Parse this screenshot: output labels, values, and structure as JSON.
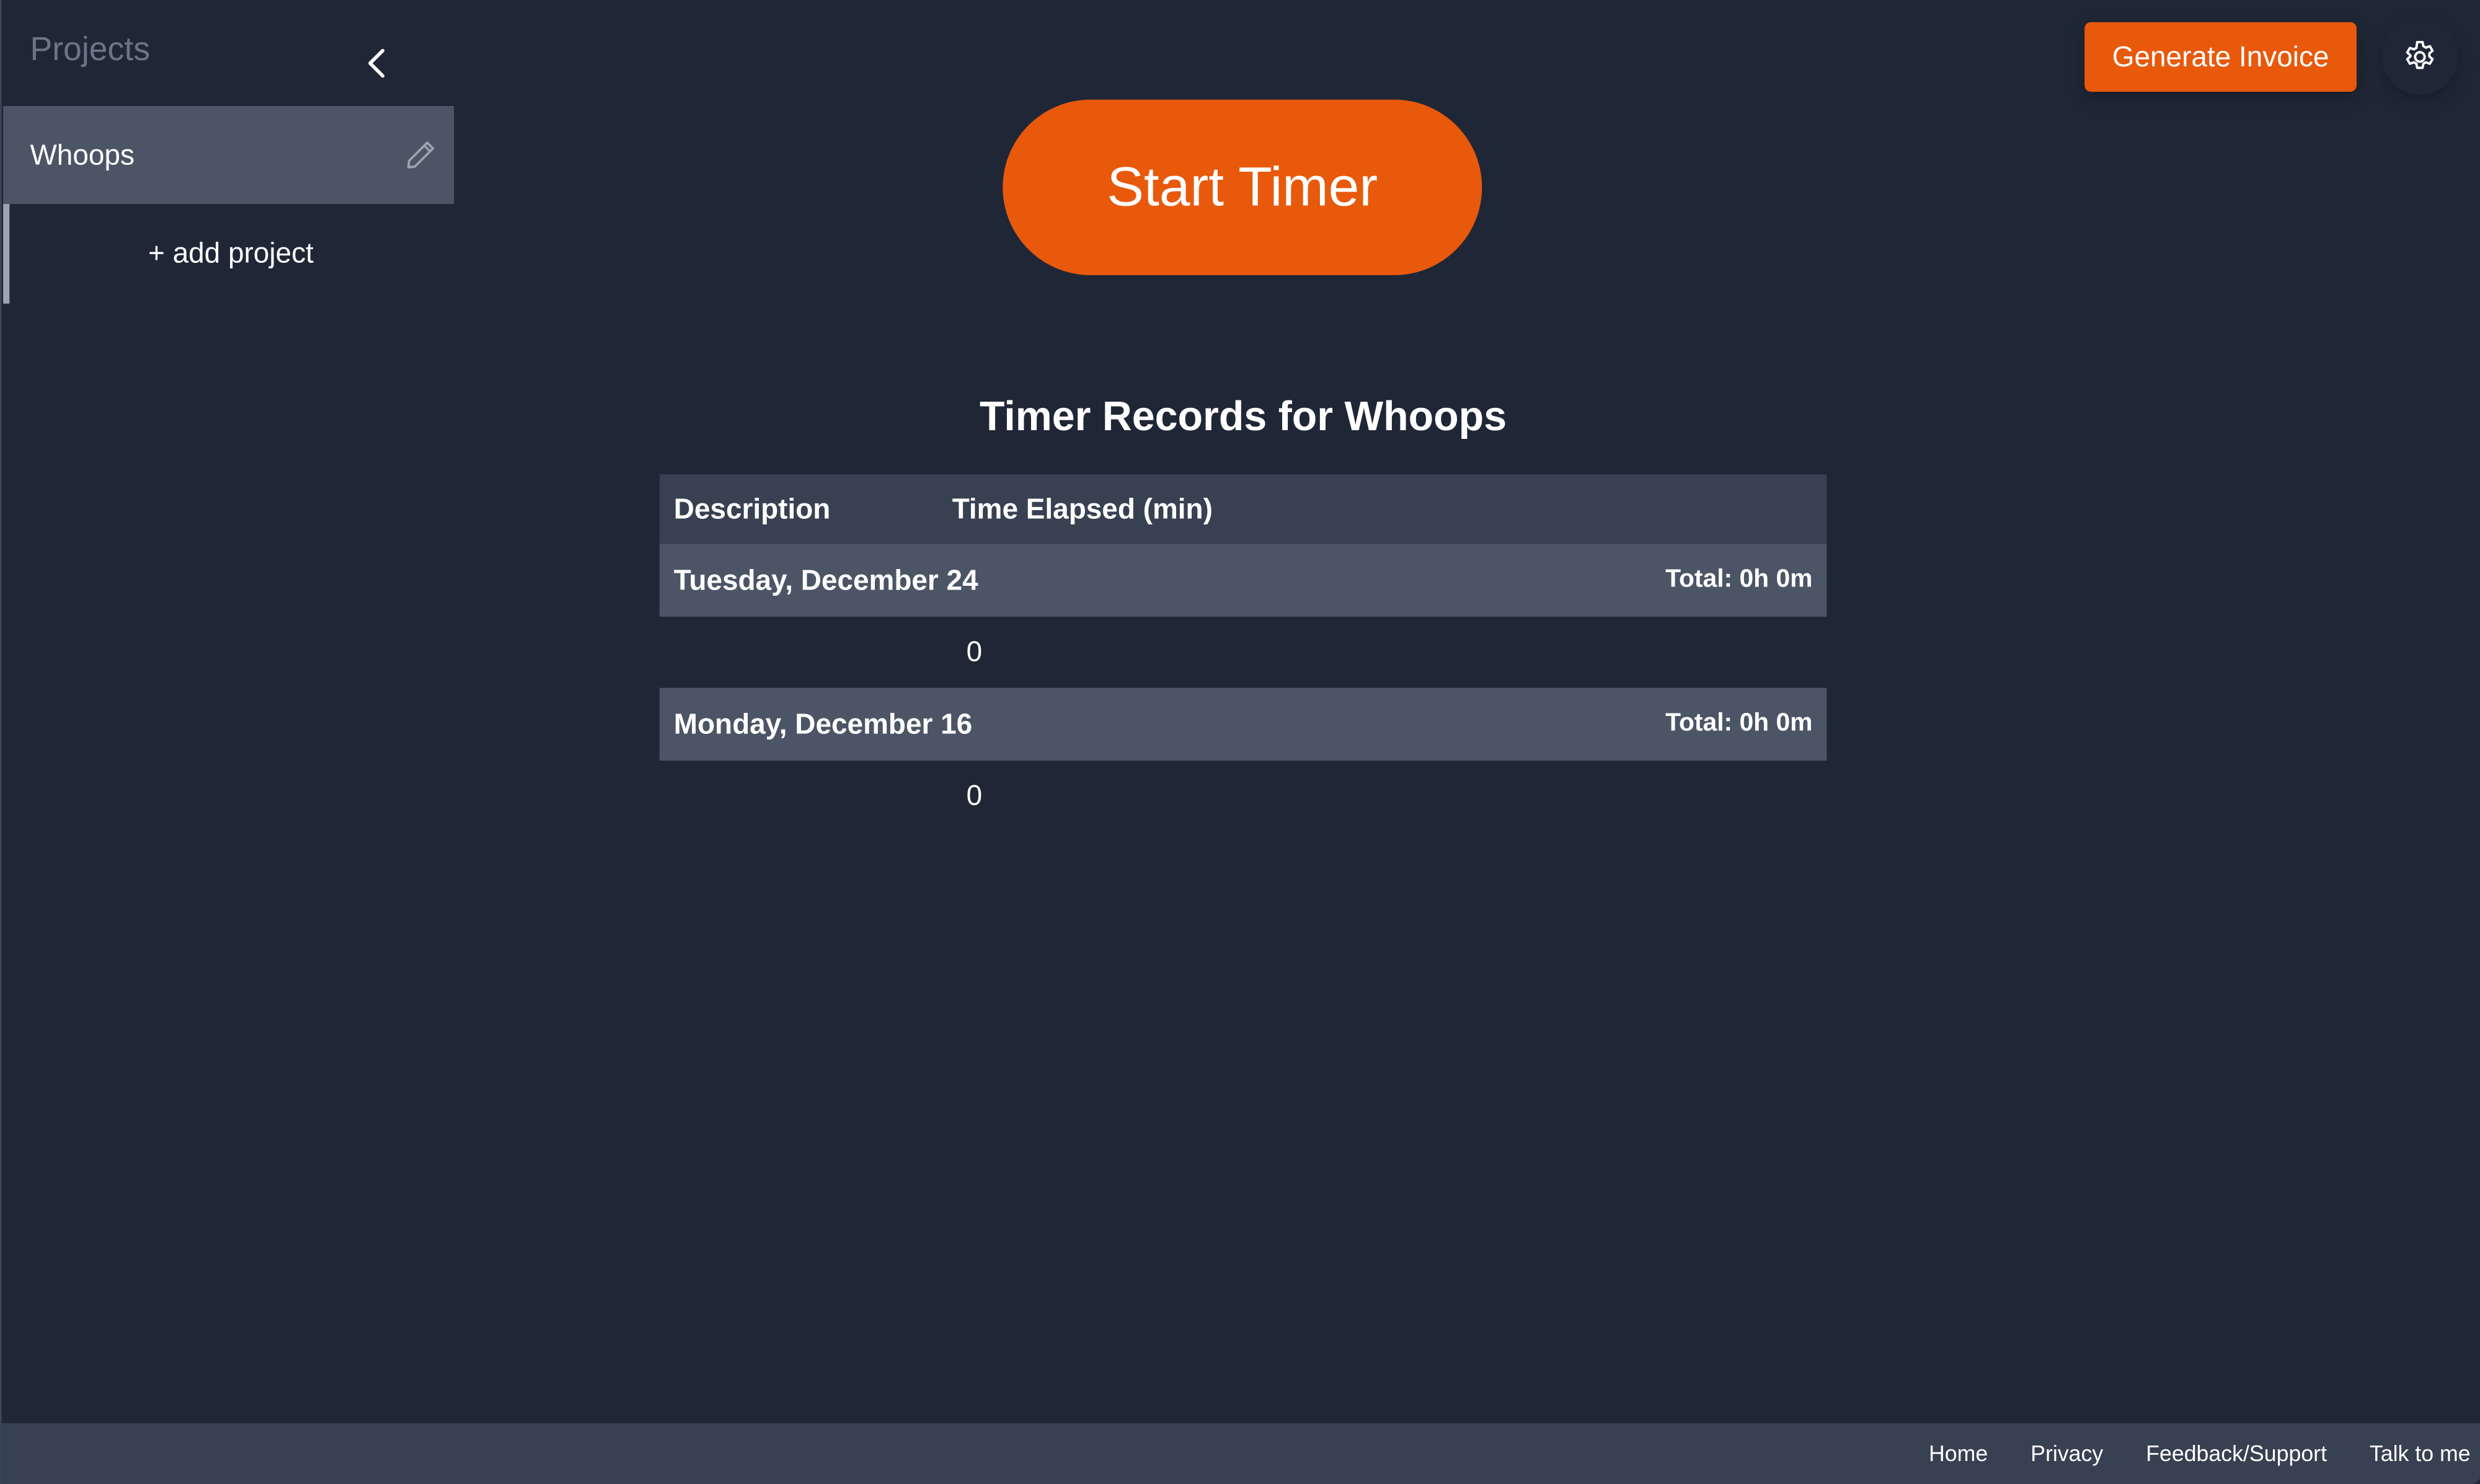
{
  "sidebar": {
    "title": "Projects",
    "projects": [
      {
        "name": "Whoops"
      }
    ],
    "add_project_label": "+ add project"
  },
  "header": {
    "generate_invoice_label": "Generate Invoice"
  },
  "timer": {
    "start_label": "Start Timer"
  },
  "records": {
    "title": "Timer Records for Whoops",
    "columns": [
      "Description",
      "Time Elapsed (min)"
    ],
    "groups": [
      {
        "date": "Tuesday, December 24",
        "total": "Total: 0h 0m",
        "entries": [
          {
            "description": "",
            "minutes": "0"
          }
        ]
      },
      {
        "date": "Monday, December 16",
        "total": "Total: 0h 0m",
        "entries": [
          {
            "description": "",
            "minutes": "0"
          }
        ]
      }
    ]
  },
  "footer": {
    "links": [
      "Home",
      "Privacy",
      "Feedback/Support",
      "Talk to me"
    ]
  },
  "colors": {
    "background": "#1f2737",
    "accent": "#e8590c",
    "selected_project": "#4b5565",
    "table_header": "#374151",
    "group_row": "#4b5565",
    "footer": "#374151",
    "muted_text": "#6b7585"
  }
}
